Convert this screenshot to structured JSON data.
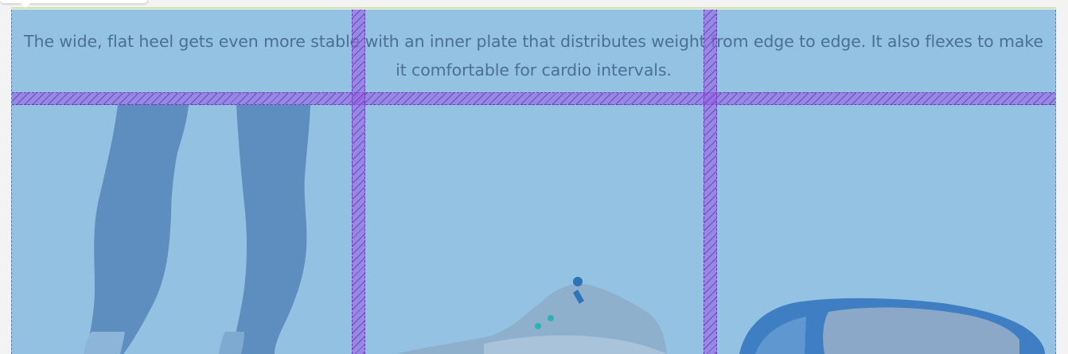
{
  "section": {
    "description": "The wide, flat heel gets even more stable with an inner plate that distributes weight from edge to edge. It also flexes to make it comfortable for cardio intervals."
  },
  "images": [
    {
      "icon": "legs-photo"
    },
    {
      "icon": "shoe-side-photo"
    },
    {
      "icon": "shoe-sole-photo"
    }
  ],
  "colors": {
    "overlay_blue": "#93c2e3",
    "gap_purple": "#9a64e6",
    "text": "#4d6f91"
  }
}
